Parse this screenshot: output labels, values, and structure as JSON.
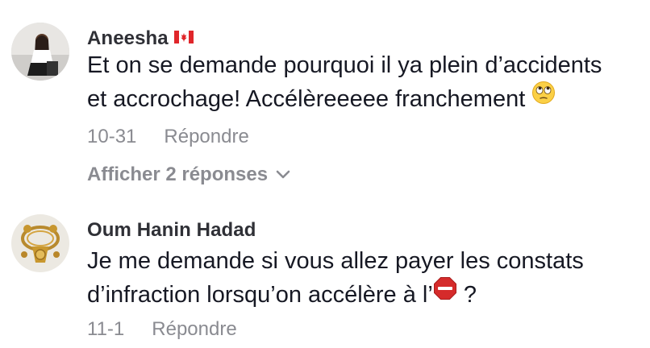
{
  "comments": [
    {
      "username": "Aneesha",
      "flag_icon": "canada-flag-icon",
      "text_line1": "Et on se demande pourquoi il ya plein d’accidents",
      "text_line2": "et accrochage! Accélèreeeee franchement",
      "text_emoji": "face-with-rolling-eyes-emoji",
      "date": "10-31",
      "reply_label": "Répondre",
      "view_replies_label": "Afficher 2 réponses"
    },
    {
      "username": "Oum Hanin Hadad",
      "text_line1": "Je me demande si vous allez payer les constats",
      "text_line2_before": "d’infraction lorsqu’on accélère à l’",
      "text_line2_after": " ?",
      "text_emoji": "stop-sign-emoji",
      "date": "11-1",
      "reply_label": "Répondre"
    }
  ],
  "colors": {
    "text": "#161823",
    "username": "#2f3036",
    "meta": "#8a8b91",
    "stop_red": "#d52b2b"
  }
}
